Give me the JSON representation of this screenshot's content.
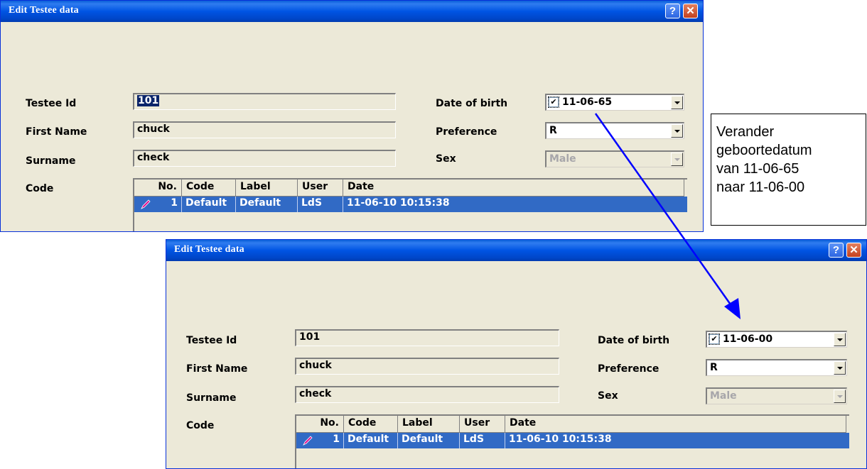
{
  "dialogs": [
    {
      "title": "Edit Testee data",
      "labels": {
        "testee_id": "Testee Id",
        "first_name": "First Name",
        "surname": "Surname",
        "code": "Code",
        "date_of_birth": "Date of birth",
        "preference": "Preference",
        "sex": "Sex"
      },
      "values": {
        "testee_id": "101",
        "first_name": "chuck",
        "surname": "check",
        "date_of_birth": "11-06-65",
        "date_checked": true,
        "preference": "R",
        "sex": "Male"
      },
      "grid": {
        "columns": [
          "No.",
          "Code",
          "Label",
          "User",
          "Date"
        ],
        "rows": [
          {
            "no": "1",
            "code": "Default",
            "label": "Default",
            "user": "LdS",
            "date": "11-06-10 10:15:38"
          }
        ]
      }
    },
    {
      "title": "Edit Testee data",
      "labels": {
        "testee_id": "Testee Id",
        "first_name": "First Name",
        "surname": "Surname",
        "code": "Code",
        "date_of_birth": "Date of birth",
        "preference": "Preference",
        "sex": "Sex"
      },
      "values": {
        "testee_id": "101",
        "first_name": "chuck",
        "surname": "check",
        "date_of_birth": "11-06-00",
        "date_checked": true,
        "preference": "R",
        "sex": "Male"
      },
      "grid": {
        "columns": [
          "No.",
          "Code",
          "Label",
          "User",
          "Date"
        ],
        "rows": [
          {
            "no": "1",
            "code": "Default",
            "label": "Default",
            "user": "LdS",
            "date": "11-06-10 10:15:38"
          }
        ]
      }
    }
  ],
  "titlebar_buttons": {
    "help": "?",
    "close": "✕"
  },
  "annotation": {
    "lines": [
      "Verander",
      "geboortedatum",
      "van 11-06-65",
      "naar 11-06-00"
    ]
  },
  "colors": {
    "titlebar": "#0054e3",
    "selection": "#316ac5",
    "arrow": "#0000ff",
    "dialog_bg": "#ece9d8"
  }
}
